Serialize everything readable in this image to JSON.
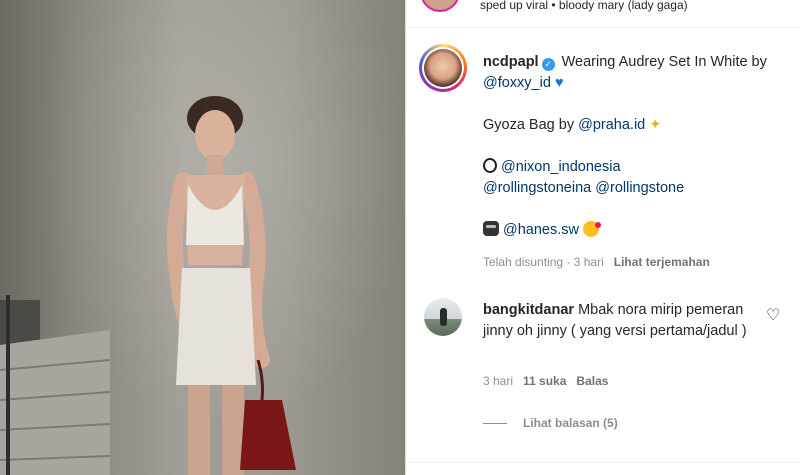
{
  "header": {
    "music": "sped up viral • bloody mary (lady gaga)"
  },
  "caption": {
    "username": "ncdpapl",
    "line1_text": "Wearing Audrey Set In White by ",
    "line1_mention": "@foxxy_id",
    "line2_text": "Gyoza Bag by ",
    "line2_mention": "@praha.id",
    "line3_mention_a": "@nixon_indonesia",
    "line3_mention_b": "@rollingstoneina",
    "line3_mention_c": "@rollingstone",
    "line4_mention": "@hanes.sw",
    "edited": "Telah disunting · 3 hari",
    "see_translation": "Lihat terjemahan"
  },
  "comment": {
    "username": "bangkitdanar",
    "text": "Mbak nora mirip pemeran jinny oh jinny ( yang versi pertama/jadul )",
    "time": "3 hari",
    "likes": "11 suka",
    "reply": "Balas",
    "view_replies": "Lihat balasan (5)"
  },
  "icons": {
    "verified": "verified-badge-icon",
    "heart": "heart-outline-icon",
    "watch": "watch-icon",
    "robot": "robot-icon",
    "sparkle": "sparkle-icon",
    "blue_heart": "blue-heart-icon",
    "kiss": "kiss-emoji-icon"
  },
  "colors": {
    "mention": "#00376b",
    "verified": "#3897f0",
    "meta": "#8e8e8e"
  }
}
